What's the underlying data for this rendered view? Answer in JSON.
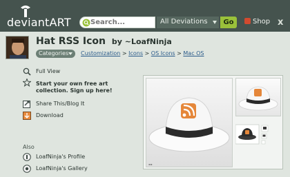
{
  "header": {
    "logo_text": "deviantART",
    "search_placeholder": "Search...",
    "scope_label": "All Deviations",
    "go_label": "Go",
    "shop_label": "Shop",
    "close_label": "x"
  },
  "deviation": {
    "title": "Hat RSS Icon",
    "by": "by ~LoafNinja",
    "categories_label": "Categories",
    "breadcrumb": [
      "Customization",
      "Icons",
      "OS Icons",
      "Mac OS"
    ],
    "breadcrumb_separator": ">"
  },
  "actions": {
    "full_view": "Full View",
    "signup": "Start your own free art collection. Sign up here!",
    "share": "Share This/Blog It",
    "download": "Download"
  },
  "also": {
    "heading": "Also",
    "profile": "LoafNinja's Profile",
    "gallery": "LoafNinja's Gallery"
  },
  "colors": {
    "header_bg": "#45534e",
    "page_bg": "#dfe5df",
    "go_green": "#9ac13a",
    "link": "#2b5b8a"
  }
}
